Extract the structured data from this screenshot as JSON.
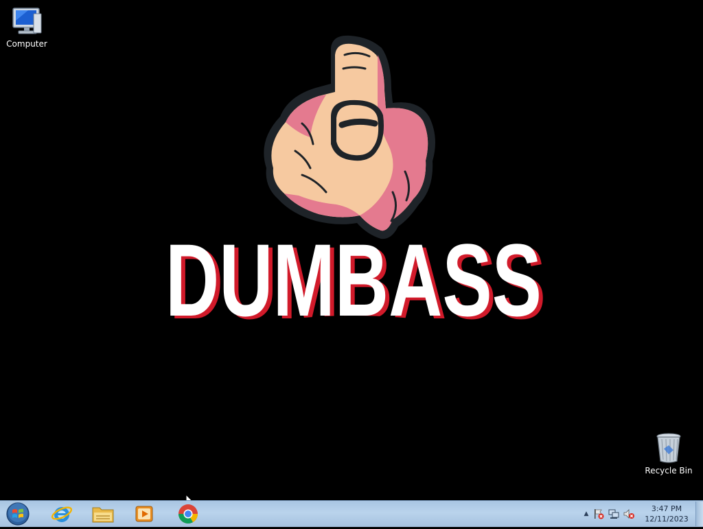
{
  "desktop": {
    "icons": [
      {
        "name": "computer",
        "label": "Computer"
      },
      {
        "name": "recycle-bin",
        "label": "Recycle Bin"
      }
    ],
    "wallpaper": {
      "headline": "DUMBASS",
      "colors": {
        "hand_light": "#f6c9a0",
        "hand_pink": "#e47a8f",
        "outline": "#1e2328",
        "text": "#ffffff",
        "text_shadow": "#d11a2a"
      }
    }
  },
  "taskbar": {
    "start_icon": "windows-start-orb-icon",
    "pinned": [
      {
        "name": "internet-explorer",
        "icon": "internet-explorer-icon"
      },
      {
        "name": "windows-explorer",
        "icon": "folder-icon"
      },
      {
        "name": "media-player",
        "icon": "media-player-icon"
      },
      {
        "name": "chrome",
        "icon": "chrome-icon"
      }
    ],
    "tray": {
      "arrow": "▲",
      "icons": [
        "action-center-flag-icon",
        "network-icon",
        "volume-muted-icon"
      ],
      "time": "3:47 PM",
      "date": "12/11/2023"
    }
  }
}
